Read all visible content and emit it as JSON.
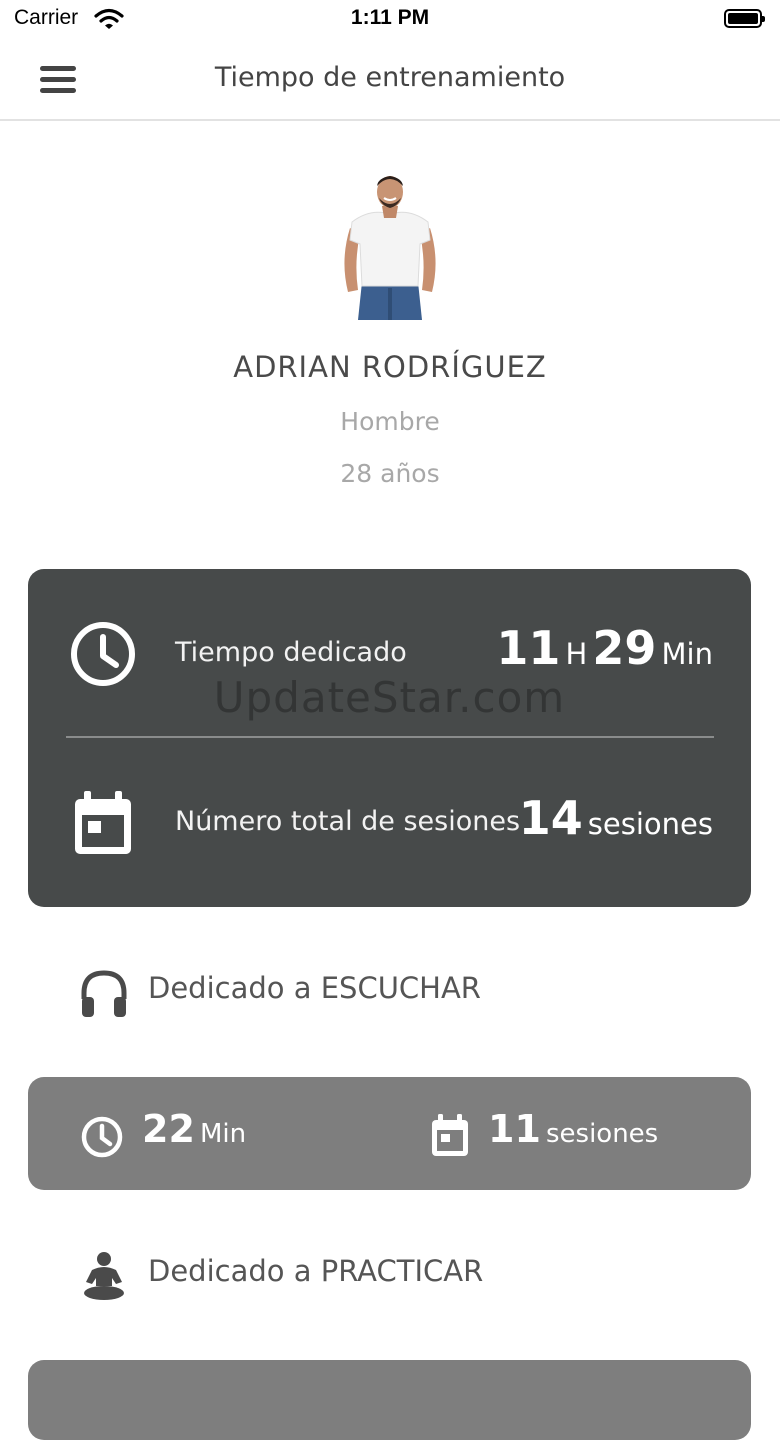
{
  "status_bar": {
    "carrier": "Carrier",
    "time": "1:11 PM"
  },
  "nav": {
    "title": "Tiempo de entrenamiento"
  },
  "profile": {
    "name": "ADRIAN RODRÍGUEZ",
    "gender": "Hombre",
    "age": "28 años"
  },
  "summary": {
    "time_label": "Tiempo dedicado",
    "hours": "11",
    "hours_unit": "H",
    "minutes": "29",
    "minutes_unit": "Min",
    "sessions_label": "Número total de sesiones",
    "sessions": "14",
    "sessions_unit": "sesiones",
    "watermark": "UpdateStar.com"
  },
  "listen": {
    "title": "Dedicado a ESCUCHAR",
    "minutes": "22",
    "minutes_unit": "Min",
    "sessions": "11",
    "sessions_unit": "sesiones"
  },
  "practice": {
    "title": "Dedicado a PRACTICAR"
  },
  "icons": {
    "wifi": "wifi-icon",
    "battery": "battery-icon",
    "menu": "hamburger-menu-icon",
    "clock": "clock-icon",
    "calendar": "calendar-icon",
    "headphones": "headphones-icon",
    "meditation": "meditation-icon"
  },
  "colors": {
    "card_dark": "#474a4a",
    "card_mid": "#7e7e7e",
    "text_gray": "#a8a8a8"
  }
}
